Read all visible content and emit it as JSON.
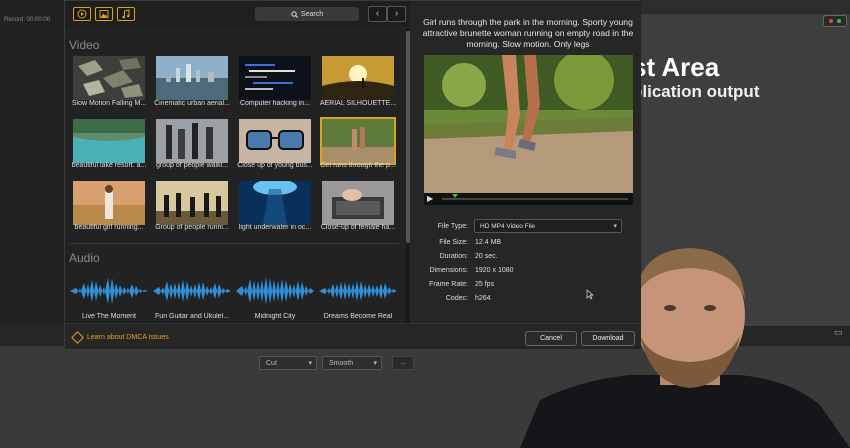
{
  "background": {
    "record_label": "Record:  00:00:00",
    "slide_title": "st Area",
    "slide_subtitle": "plication output",
    "toolbar_dropdowns": [
      "Cut",
      "Smooth"
    ],
    "arrow_label": "→"
  },
  "dialog": {
    "tabs": [
      {
        "name": "video-tab",
        "icon": "play-circle-icon"
      },
      {
        "name": "image-tab",
        "icon": "image-icon"
      },
      {
        "name": "audio-tab",
        "icon": "music-note-icon"
      }
    ],
    "search_label": "Search",
    "nav_prev": "‹",
    "nav_next": "›",
    "video_heading": "Video",
    "audio_heading": "Audio",
    "videos": [
      {
        "title": "Slow Motion Falling M...",
        "selected": false
      },
      {
        "title": "Cinematic urban aerial...",
        "selected": false
      },
      {
        "title": "Computer hacking in...",
        "selected": false
      },
      {
        "title": "AERIAL SILHOUETTE...",
        "selected": false
      },
      {
        "title": "beautiful lake resort. a...",
        "selected": false
      },
      {
        "title": "group of people walki...",
        "selected": false
      },
      {
        "title": "Close up of young bus...",
        "selected": false
      },
      {
        "title": "Girl runs through the p...",
        "selected": true
      },
      {
        "title": "beautiful girl running...",
        "selected": false
      },
      {
        "title": "Group of people runni...",
        "selected": false
      },
      {
        "title": "light underwater in oc...",
        "selected": false
      },
      {
        "title": "Close-up of female ha...",
        "selected": false
      }
    ],
    "audio": [
      {
        "title": "Live The Moment"
      },
      {
        "title": "Fun Guitar and Ukulel..."
      },
      {
        "title": "Midnight City"
      },
      {
        "title": "Dreams Become Real"
      }
    ],
    "preview": {
      "description": "Girl runs through the park in the morning. Sporty young attractive brunette woman running on empty road in the morning. Slow motion. Only legs",
      "play_icon": "▶",
      "progress": 0.07,
      "file_type_label": "File Type:",
      "file_type_value": "HD MP4 Video File",
      "fields": [
        {
          "label": "File Size:",
          "value": "12.4 MB"
        },
        {
          "label": "Duration:",
          "value": "20 sec."
        },
        {
          "label": "Dimensions:",
          "value": "1920 x 1080"
        },
        {
          "label": "Frame Rate:",
          "value": "25 fps"
        },
        {
          "label": "Codec:",
          "value": "h264"
        }
      ]
    },
    "footer": {
      "dmca_link": "Learn about DMCA Issues",
      "cancel": "Cancel",
      "download": "Download"
    }
  },
  "colors": {
    "accent": "#d6a51e",
    "waveform": "#2f8fd8",
    "progress_marker": "#3dbb3d"
  }
}
